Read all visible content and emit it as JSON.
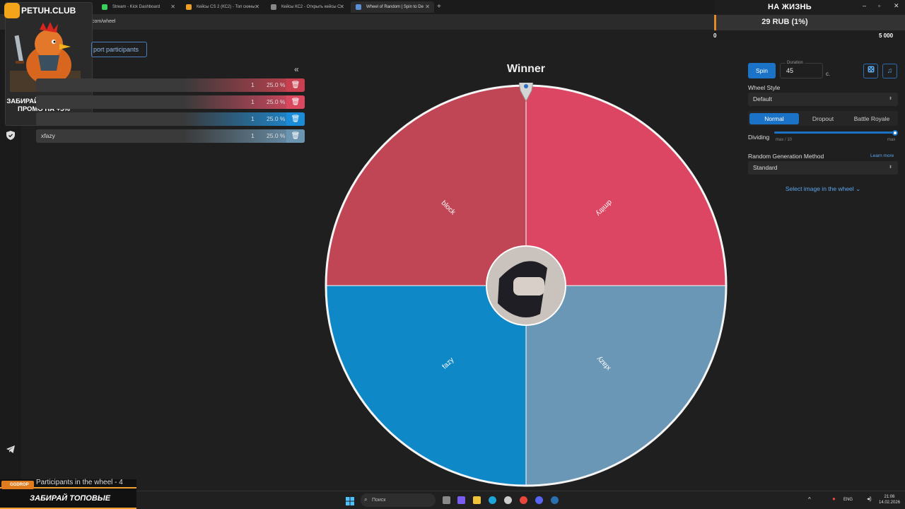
{
  "browser": {
    "tabs": [
      {
        "label": "Stream - Kick Dashboard",
        "color": "#3ad15a"
      },
      {
        "label": "Кейсы CS 2 (КС2) - Топ скины",
        "color": "#f0a020"
      },
      {
        "label": "Кейсы КС2 - Открыть кейсы С",
        "color": "#888888"
      },
      {
        "label": "Wheel of Random | Spin to De",
        "color": "#5a8fd6"
      }
    ],
    "url": "com/wheel"
  },
  "donation": {
    "title": "НА ЖИЗНЬ",
    "amount": "29 RUB (1%)",
    "min": "0",
    "max": "5 000",
    "progress": 0.01,
    "accent": "#e08a2a"
  },
  "promo": {
    "brand": "PETUH.CLUB",
    "text": "ЗАБИРАЙ ЛИМИТНЫЙ ПРОМО НА +5%"
  },
  "participants": {
    "import_label": "port participants",
    "collapse_icon": "«",
    "rows": [
      {
        "name": "",
        "count": "1",
        "percent": "25.0 %",
        "color": "#c8404f"
      },
      {
        "name": "",
        "count": "1",
        "percent": "25.0 %",
        "color": "#d9485f"
      },
      {
        "name": "",
        "count": "1",
        "percent": "25.0 %",
        "color": "#1a8cd8"
      },
      {
        "name": "xfazy",
        "count": "1",
        "percent": "25.0 %",
        "color": "#6b94b0"
      }
    ],
    "footer": "Participants in the wheel - 4"
  },
  "wheel": {
    "title": "Winner",
    "segments": [
      {
        "name": "dmitry",
        "color": "#dc4663",
        "share": 0.25
      },
      {
        "name": "xfazy",
        "color": "#6a97b5",
        "share": 0.25
      },
      {
        "name": "fazy",
        "color": "#0f88c8",
        "share": 0.25
      },
      {
        "name": "block",
        "color": "#c04555",
        "share": 0.25
      }
    ]
  },
  "settings": {
    "spin_label": "Spin",
    "duration_label": "Duration",
    "duration_value": "45",
    "duration_unit": "с.",
    "wheel_style_label": "Wheel Style",
    "wheel_style_value": "Default",
    "modes": [
      "Normal",
      "Dropout",
      "Battle Royale"
    ],
    "active_mode": "Normal",
    "dividing_label": "Dividing",
    "dividing_min": "max / 10",
    "dividing_max": "max",
    "dividing_value": 1.0,
    "random_method_label": "Random Generation Method",
    "learn_more": "Learn more",
    "random_method_value": "Standard",
    "select_image": "Select image in the wheel"
  },
  "taskbar": {
    "search_placeholder": "Поиск",
    "lang": "ENG",
    "time": "21:06",
    "date": "14.02.2026"
  },
  "banner": {
    "logo": "GGDROP",
    "text": "ЗАБИРАЙ  ТОПОВЫЕ"
  }
}
